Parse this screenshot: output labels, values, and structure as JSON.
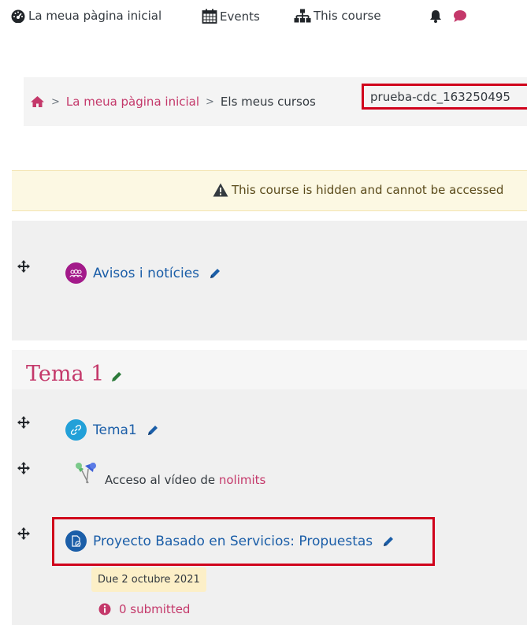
{
  "topnav": {
    "home_label": "La meua pàgina inicial",
    "events_label": "Events",
    "course_label": "This course"
  },
  "breadcrumb": {
    "home_link": "La meua pàgina inicial",
    "courses": "Els meus cursos",
    "current": "prueba-cdc_163250495"
  },
  "alert": {
    "text": "This course is hidden and cannot be accessed"
  },
  "section0": {
    "activities": [
      {
        "name": "Avisos i notícies",
        "icon": "forum-icon"
      }
    ]
  },
  "section1": {
    "title": "Tema 1",
    "activities": [
      {
        "name": "Tema1",
        "icon": "url-link-icon"
      }
    ],
    "label": {
      "text": "Acceso al vídeo de ",
      "link": "nolimits"
    },
    "assignment": {
      "name": "Proyecto Basado en Servicios: Propuestas",
      "due": "Due 2 octubre 2021",
      "submitted": "0 submitted"
    }
  },
  "colors": {
    "brand": "#c4386a",
    "link": "#1b5ea8",
    "highlight": "#d0021b",
    "alert_bg": "#fcf8e3"
  }
}
